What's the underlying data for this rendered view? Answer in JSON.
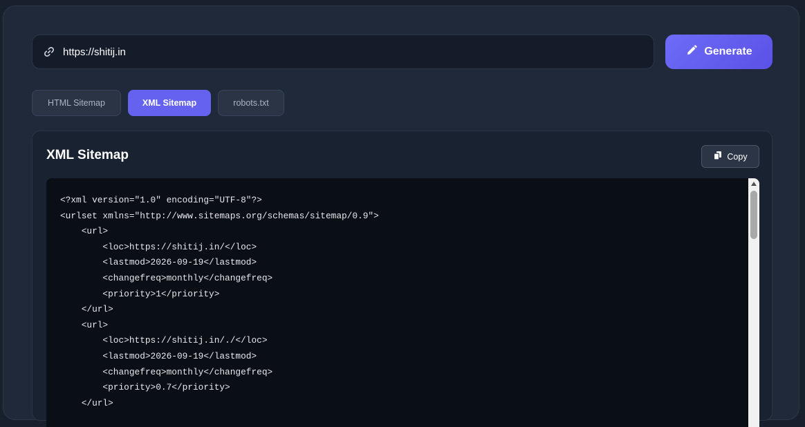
{
  "url_bar": {
    "value": "https://shitij.in",
    "icon": "link-icon"
  },
  "generate_button": {
    "label": "Generate",
    "icon": "pencil-icon"
  },
  "tabs": [
    {
      "label": "HTML Sitemap",
      "active": false
    },
    {
      "label": "XML Sitemap",
      "active": true
    },
    {
      "label": "robots.txt",
      "active": false
    }
  ],
  "panel": {
    "title": "XML Sitemap",
    "copy_label": "Copy",
    "copy_icon": "copy-icon",
    "code_lines": [
      "<?xml version=\"1.0\" encoding=\"UTF-8\"?>",
      "<urlset xmlns=\"http://www.sitemaps.org/schemas/sitemap/0.9\">",
      "    <url>",
      "        <loc>https://shitij.in/</loc>",
      "        <lastmod>2026-09-19</lastmod>",
      "        <changefreq>monthly</changefreq>",
      "        <priority>1</priority>",
      "    </url>",
      "    <url>",
      "        <loc>https://shitij.in/./</loc>",
      "        <lastmod>2026-09-19</lastmod>",
      "        <changefreq>monthly</changefreq>",
      "        <priority>0.7</priority>",
      "    </url>"
    ]
  },
  "colors": {
    "accent": "#6562f0",
    "background": "#18202e",
    "card": "#1f293a",
    "code_background": "#0a0e15"
  }
}
